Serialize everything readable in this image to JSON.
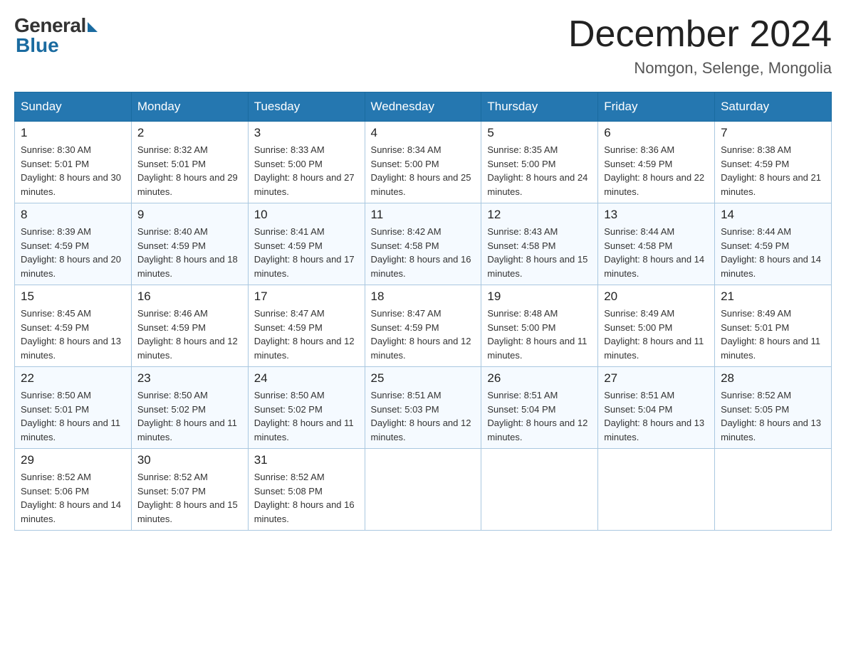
{
  "logo": {
    "general": "General",
    "blue": "Blue"
  },
  "title": "December 2024",
  "location": "Nomgon, Selenge, Mongolia",
  "days_of_week": [
    "Sunday",
    "Monday",
    "Tuesday",
    "Wednesday",
    "Thursday",
    "Friday",
    "Saturday"
  ],
  "weeks": [
    [
      {
        "day": "1",
        "sunrise": "8:30 AM",
        "sunset": "5:01 PM",
        "daylight": "8 hours and 30 minutes."
      },
      {
        "day": "2",
        "sunrise": "8:32 AM",
        "sunset": "5:01 PM",
        "daylight": "8 hours and 29 minutes."
      },
      {
        "day": "3",
        "sunrise": "8:33 AM",
        "sunset": "5:00 PM",
        "daylight": "8 hours and 27 minutes."
      },
      {
        "day": "4",
        "sunrise": "8:34 AM",
        "sunset": "5:00 PM",
        "daylight": "8 hours and 25 minutes."
      },
      {
        "day": "5",
        "sunrise": "8:35 AM",
        "sunset": "5:00 PM",
        "daylight": "8 hours and 24 minutes."
      },
      {
        "day": "6",
        "sunrise": "8:36 AM",
        "sunset": "4:59 PM",
        "daylight": "8 hours and 22 minutes."
      },
      {
        "day": "7",
        "sunrise": "8:38 AM",
        "sunset": "4:59 PM",
        "daylight": "8 hours and 21 minutes."
      }
    ],
    [
      {
        "day": "8",
        "sunrise": "8:39 AM",
        "sunset": "4:59 PM",
        "daylight": "8 hours and 20 minutes."
      },
      {
        "day": "9",
        "sunrise": "8:40 AM",
        "sunset": "4:59 PM",
        "daylight": "8 hours and 18 minutes."
      },
      {
        "day": "10",
        "sunrise": "8:41 AM",
        "sunset": "4:59 PM",
        "daylight": "8 hours and 17 minutes."
      },
      {
        "day": "11",
        "sunrise": "8:42 AM",
        "sunset": "4:58 PM",
        "daylight": "8 hours and 16 minutes."
      },
      {
        "day": "12",
        "sunrise": "8:43 AM",
        "sunset": "4:58 PM",
        "daylight": "8 hours and 15 minutes."
      },
      {
        "day": "13",
        "sunrise": "8:44 AM",
        "sunset": "4:58 PM",
        "daylight": "8 hours and 14 minutes."
      },
      {
        "day": "14",
        "sunrise": "8:44 AM",
        "sunset": "4:59 PM",
        "daylight": "8 hours and 14 minutes."
      }
    ],
    [
      {
        "day": "15",
        "sunrise": "8:45 AM",
        "sunset": "4:59 PM",
        "daylight": "8 hours and 13 minutes."
      },
      {
        "day": "16",
        "sunrise": "8:46 AM",
        "sunset": "4:59 PM",
        "daylight": "8 hours and 12 minutes."
      },
      {
        "day": "17",
        "sunrise": "8:47 AM",
        "sunset": "4:59 PM",
        "daylight": "8 hours and 12 minutes."
      },
      {
        "day": "18",
        "sunrise": "8:47 AM",
        "sunset": "4:59 PM",
        "daylight": "8 hours and 12 minutes."
      },
      {
        "day": "19",
        "sunrise": "8:48 AM",
        "sunset": "5:00 PM",
        "daylight": "8 hours and 11 minutes."
      },
      {
        "day": "20",
        "sunrise": "8:49 AM",
        "sunset": "5:00 PM",
        "daylight": "8 hours and 11 minutes."
      },
      {
        "day": "21",
        "sunrise": "8:49 AM",
        "sunset": "5:01 PM",
        "daylight": "8 hours and 11 minutes."
      }
    ],
    [
      {
        "day": "22",
        "sunrise": "8:50 AM",
        "sunset": "5:01 PM",
        "daylight": "8 hours and 11 minutes."
      },
      {
        "day": "23",
        "sunrise": "8:50 AM",
        "sunset": "5:02 PM",
        "daylight": "8 hours and 11 minutes."
      },
      {
        "day": "24",
        "sunrise": "8:50 AM",
        "sunset": "5:02 PM",
        "daylight": "8 hours and 11 minutes."
      },
      {
        "day": "25",
        "sunrise": "8:51 AM",
        "sunset": "5:03 PM",
        "daylight": "8 hours and 12 minutes."
      },
      {
        "day": "26",
        "sunrise": "8:51 AM",
        "sunset": "5:04 PM",
        "daylight": "8 hours and 12 minutes."
      },
      {
        "day": "27",
        "sunrise": "8:51 AM",
        "sunset": "5:04 PM",
        "daylight": "8 hours and 13 minutes."
      },
      {
        "day": "28",
        "sunrise": "8:52 AM",
        "sunset": "5:05 PM",
        "daylight": "8 hours and 13 minutes."
      }
    ],
    [
      {
        "day": "29",
        "sunrise": "8:52 AM",
        "sunset": "5:06 PM",
        "daylight": "8 hours and 14 minutes."
      },
      {
        "day": "30",
        "sunrise": "8:52 AM",
        "sunset": "5:07 PM",
        "daylight": "8 hours and 15 minutes."
      },
      {
        "day": "31",
        "sunrise": "8:52 AM",
        "sunset": "5:08 PM",
        "daylight": "8 hours and 16 minutes."
      },
      null,
      null,
      null,
      null
    ]
  ]
}
